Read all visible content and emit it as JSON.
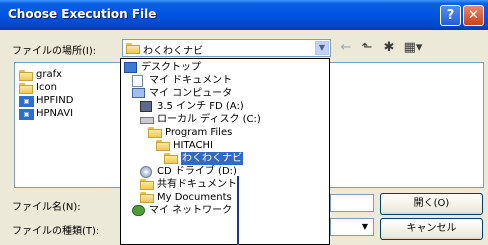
{
  "window": {
    "title": "Choose Execution File",
    "help_label": "?",
    "close_label": "✕"
  },
  "look_in": {
    "label": "ファイルの場所(I):",
    "value": "わくわくナビ"
  },
  "toolbar": {
    "back_icon": "←",
    "up_icon": "⬑",
    "new_folder_icon": "✱",
    "views_icon": "▦▾"
  },
  "files": [
    {
      "name": "grafx",
      "icon": "folder-icon"
    },
    {
      "name": "Icon",
      "icon": "folder-icon"
    },
    {
      "name": "HPFIND",
      "icon": "exe-icon"
    },
    {
      "name": "HPNAVI",
      "icon": "exe-icon"
    }
  ],
  "file_name": {
    "label": "ファイル名(N):",
    "value": ""
  },
  "file_type": {
    "label": "ファイルの種類(T):",
    "value": ""
  },
  "buttons": {
    "open": "開く(O)",
    "cancel": "キャンセル"
  },
  "dropdown_items": [
    {
      "label": "デスクトップ",
      "icon": "desktop-icon",
      "indent": 0
    },
    {
      "label": "マイ ドキュメント",
      "icon": "documents-icon",
      "indent": 1
    },
    {
      "label": "マイ コンピュータ",
      "icon": "computer-icon",
      "indent": 1
    },
    {
      "label": "3.5 インチ FD (A:)",
      "icon": "floppy-icon",
      "indent": 2
    },
    {
      "label": "ローカル ディスク (C:)",
      "icon": "hard-disk-icon",
      "indent": 2
    },
    {
      "label": "Program Files",
      "icon": "folder-icon",
      "indent": 3
    },
    {
      "label": "HITACHI",
      "icon": "folder-icon",
      "indent": 4
    },
    {
      "label": "わくわくナビ",
      "icon": "folder-open-icon",
      "indent": 5,
      "selected": true
    },
    {
      "label": "CD ドライブ (D:)",
      "icon": "cd-drive-icon",
      "indent": 2
    },
    {
      "label": "共有ドキュメント",
      "icon": "folder-icon",
      "indent": 2
    },
    {
      "label": "My Documents",
      "icon": "folder-icon",
      "indent": 2
    },
    {
      "label": "マイ ネットワーク",
      "icon": "network-icon",
      "indent": 1
    }
  ]
}
